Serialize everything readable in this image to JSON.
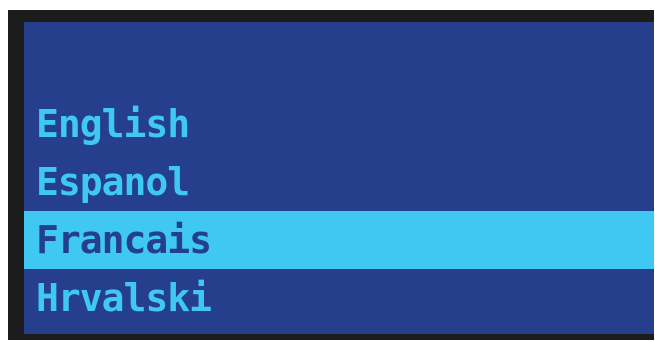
{
  "menu": {
    "items": [
      {
        "label": "English",
        "selected": false
      },
      {
        "label": "Espanol",
        "selected": false
      },
      {
        "label": "Francais",
        "selected": true
      },
      {
        "label": "Hrvalski",
        "selected": false
      }
    ],
    "selected_index": 2
  },
  "colors": {
    "background": "#253f8d",
    "text": "#3ec8f2",
    "highlight": "#3ec8f2",
    "highlight_text": "#253f8d",
    "frame": "#1c1c1c"
  }
}
